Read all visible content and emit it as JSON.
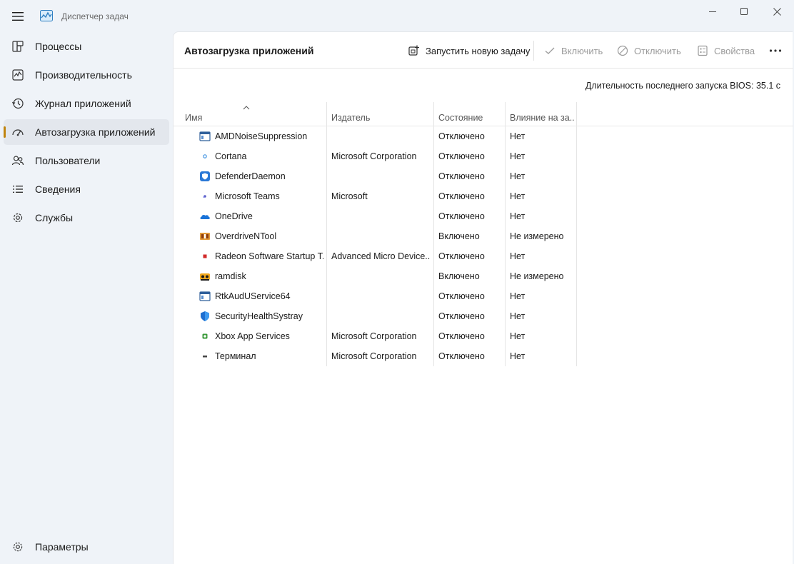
{
  "window": {
    "title": "Диспетчер задач"
  },
  "sidebar": {
    "items": [
      {
        "label": "Процессы",
        "icon": "processes-icon"
      },
      {
        "label": "Производительность",
        "icon": "performance-icon"
      },
      {
        "label": "Журнал приложений",
        "icon": "app-history-icon"
      },
      {
        "label": "Автозагрузка приложений",
        "icon": "startup-apps-icon",
        "active": true
      },
      {
        "label": "Пользователи",
        "icon": "users-icon"
      },
      {
        "label": "Сведения",
        "icon": "details-icon"
      },
      {
        "label": "Службы",
        "icon": "services-icon"
      }
    ],
    "settings_label": "Параметры"
  },
  "header": {
    "title": "Автозагрузка приложений",
    "run_new_task": "Запустить новую задачу",
    "enable": "Включить",
    "disable": "Отключить",
    "properties": "Свойства"
  },
  "bios_text": "Длительность последнего запуска BIOS: 35.1 с",
  "table": {
    "columns": [
      "Имя",
      "Издатель",
      "Состояние",
      "Влияние на за..."
    ],
    "rows": [
      {
        "name": "AMDNoiseSuppression",
        "publisher": "",
        "status": "Отключено",
        "impact": "Нет",
        "icon": "window-app-icon"
      },
      {
        "name": "Cortana",
        "publisher": "Microsoft Corporation",
        "status": "Отключено",
        "impact": "Нет",
        "icon": "cortana-icon"
      },
      {
        "name": "DefenderDaemon",
        "publisher": "",
        "status": "Отключено",
        "impact": "Нет",
        "icon": "defender-icon"
      },
      {
        "name": "Microsoft Teams",
        "publisher": "Microsoft",
        "status": "Отключено",
        "impact": "Нет",
        "icon": "teams-icon"
      },
      {
        "name": "OneDrive",
        "publisher": "",
        "status": "Отключено",
        "impact": "Нет",
        "icon": "onedrive-icon"
      },
      {
        "name": "OverdriveNTool",
        "publisher": "",
        "status": "Включено",
        "impact": "Не измерено",
        "icon": "overdrive-icon"
      },
      {
        "name": "Radeon Software Startup T...",
        "publisher": "Advanced Micro Device...",
        "status": "Отключено",
        "impact": "Нет",
        "icon": "radeon-icon"
      },
      {
        "name": "ramdisk",
        "publisher": "",
        "status": "Включено",
        "impact": "Не измерено",
        "icon": "ramdisk-icon"
      },
      {
        "name": "RtkAudUService64",
        "publisher": "",
        "status": "Отключено",
        "impact": "Нет",
        "icon": "window-app-icon"
      },
      {
        "name": "SecurityHealthSystray",
        "publisher": "",
        "status": "Отключено",
        "impact": "Нет",
        "icon": "security-shield-icon"
      },
      {
        "name": "Xbox App Services",
        "publisher": "Microsoft Corporation",
        "status": "Отключено",
        "impact": "Нет",
        "icon": "xbox-icon"
      },
      {
        "name": "Терминал",
        "publisher": "Microsoft Corporation",
        "status": "Отключено",
        "impact": "Нет",
        "icon": "terminal-icon"
      }
    ]
  },
  "colors": {
    "accent": "#c0840e",
    "sidebar_bg": "#eff3f8",
    "content_bg": "#ffffff"
  }
}
